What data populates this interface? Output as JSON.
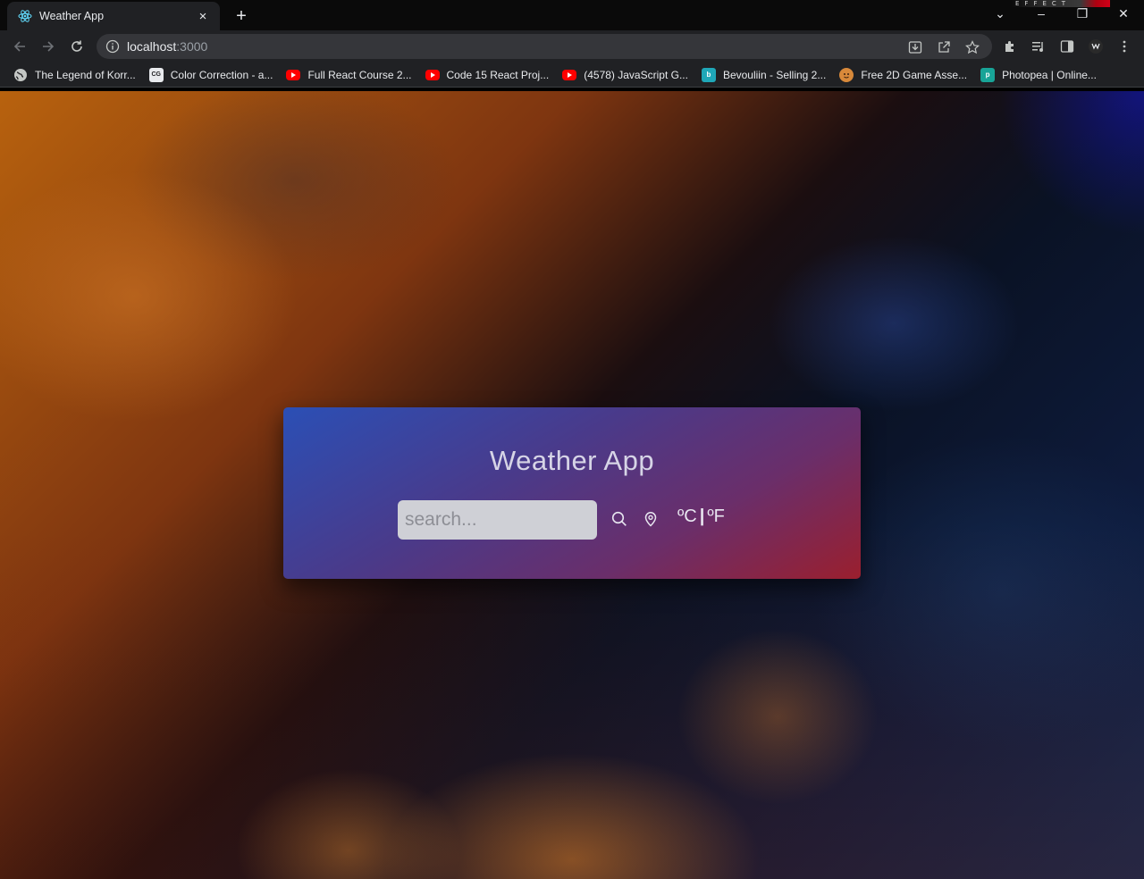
{
  "browser": {
    "tab": {
      "title": "Weather App",
      "close_glyph": "×",
      "favicon": "react-icon"
    },
    "new_tab_glyph": "+",
    "address": {
      "host": "localhost",
      "port": ":3000"
    },
    "window_controls": {
      "dropdown": "⌄",
      "minimize": "–",
      "restore": "❐",
      "close": "✕"
    },
    "brand_text": "EFFECT",
    "bookmarks": [
      {
        "label": "The Legend of Korr...",
        "icon": "globe-icon"
      },
      {
        "label": "Color Correction - a...",
        "icon": "cg-icon"
      },
      {
        "label": "Full React Course 2...",
        "icon": "youtube-icon"
      },
      {
        "label": "Code 15 React Proj...",
        "icon": "youtube-icon"
      },
      {
        "label": "(4578) JavaScript G...",
        "icon": "youtube-icon"
      },
      {
        "label": "Bevouliin - Selling 2...",
        "icon": "bevouliin-icon"
      },
      {
        "label": "Free 2D Game Asse...",
        "icon": "game-asset-icon"
      },
      {
        "label": "Photopea | Online...",
        "icon": "photopea-icon"
      }
    ]
  },
  "app": {
    "title": "Weather App",
    "search": {
      "placeholder": "search...",
      "value": ""
    },
    "units": {
      "celsius": "ºC",
      "separator": "|",
      "fahrenheit": "ºF"
    }
  },
  "colors": {
    "card_gradient_start": "#2b4fb5",
    "card_gradient_end": "#9a1f2e",
    "input_background": "#cfd0d6",
    "chrome_background": "#202124"
  }
}
